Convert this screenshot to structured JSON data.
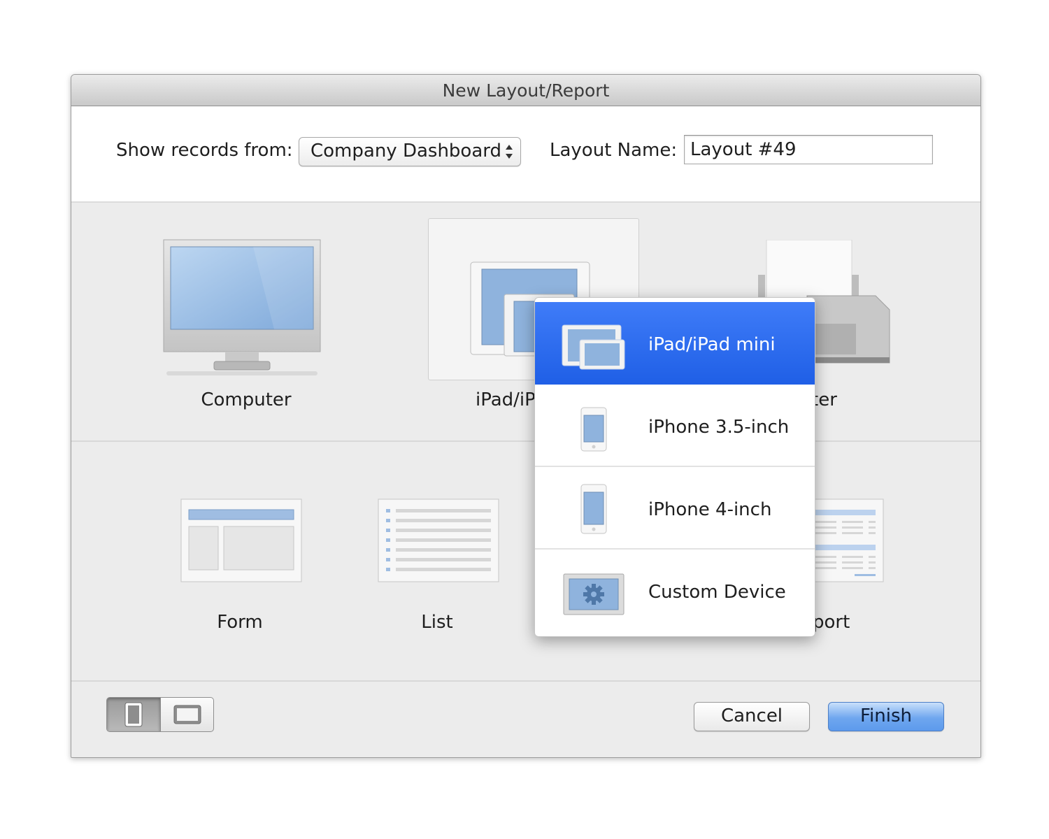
{
  "window": {
    "title": "New Layout/Report"
  },
  "header": {
    "show_records_label": "Show records from:",
    "show_records_value": "Company Dashboard",
    "layout_name_label": "Layout Name:",
    "layout_name_value": "Layout #49"
  },
  "devices": {
    "computer_label": "Computer",
    "ipad_label_visible": "iPad/iP",
    "printer_label_visible": "ter"
  },
  "themes": {
    "form_label": "Form",
    "list_label": "List",
    "report_label_visible": "port"
  },
  "menu": {
    "items": [
      {
        "label": "iPad/iPad mini",
        "icon": "ipad-devices-icon",
        "selected": true
      },
      {
        "label": "iPhone 3.5-inch",
        "icon": "iphone-icon",
        "selected": false
      },
      {
        "label": "iPhone 4-inch",
        "icon": "iphone-tall-icon",
        "selected": false
      },
      {
        "label": "Custom Device",
        "icon": "custom-device-gear-icon",
        "selected": false
      }
    ]
  },
  "footer": {
    "orientation": {
      "selected": "portrait"
    },
    "cancel_label": "Cancel",
    "finish_label": "Finish"
  }
}
